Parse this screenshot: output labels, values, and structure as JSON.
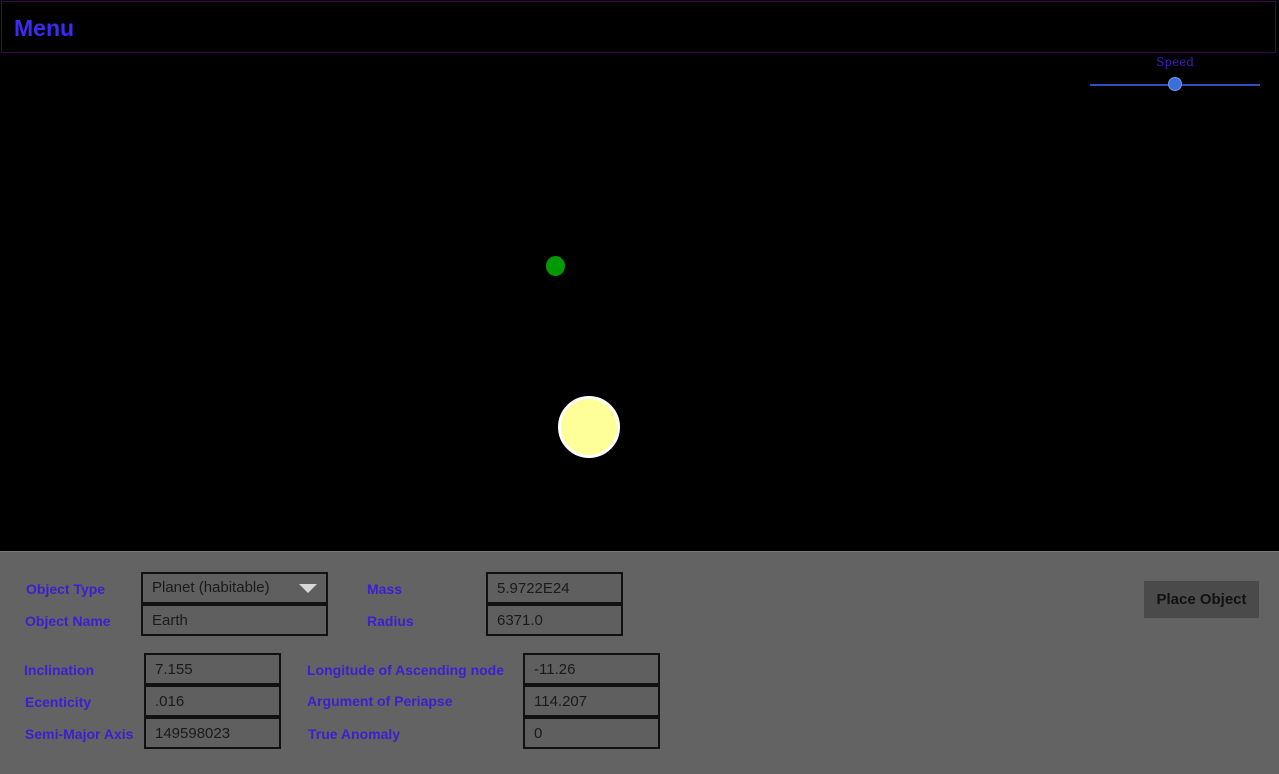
{
  "menu": {
    "title": "Menu"
  },
  "speed": {
    "label": "Speed",
    "value": 0.5
  },
  "scene": {
    "planet_color": "#009900",
    "star_color": "#ffff99",
    "star_border": "#ffffff"
  },
  "form": {
    "object_type": {
      "label": "Object Type",
      "value": "Planet (habitable)"
    },
    "object_name": {
      "label": "Object Name",
      "value": "Earth"
    },
    "mass": {
      "label": "Mass",
      "value": "5.9722E24"
    },
    "radius": {
      "label": "Radius",
      "value": "6371.0"
    },
    "inclination": {
      "label": "Inclination",
      "value": "7.155"
    },
    "eccentricity": {
      "label": "Ecenticity",
      "value": ".016"
    },
    "semi_major_axis": {
      "label": "Semi-Major Axis",
      "value": "149598023"
    },
    "longitude_ascending_node": {
      "label": "Longitude of Ascending node",
      "value": "-11.26"
    },
    "argument_periapse": {
      "label": "Argument of Periapse",
      "value": "114.207"
    },
    "true_anomaly": {
      "label": "True Anomaly",
      "value": "0"
    },
    "place_button": "Place Object"
  },
  "colors": {
    "accent": "#3d2cf0",
    "label": "#3b1fd0",
    "panel": "#636363"
  }
}
